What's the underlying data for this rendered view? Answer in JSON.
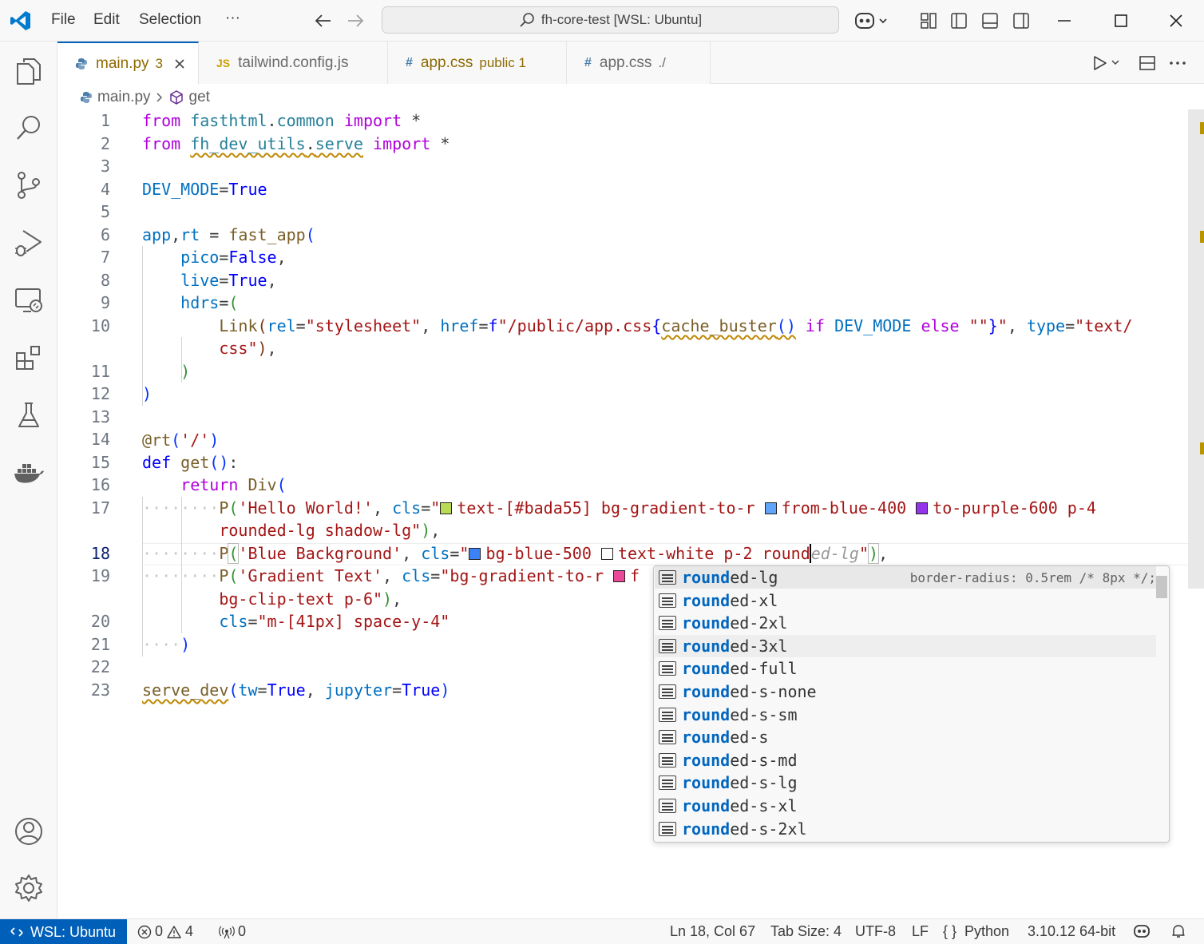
{
  "titlebar": {
    "menu": [
      "File",
      "Edit",
      "Selection"
    ],
    "more": "···",
    "command_center": "fh-core-test [WSL: Ubuntu]"
  },
  "tabs": [
    {
      "icon": "python-icon",
      "label": "main.py",
      "desc": "3",
      "active": true
    },
    {
      "icon": "JS",
      "label": "tailwind.config.js",
      "desc": ""
    },
    {
      "icon": "#",
      "label": "app.css",
      "desc": "public 1"
    },
    {
      "icon": "#",
      "label": "app.css",
      "desc": "./"
    }
  ],
  "breadcrumb": {
    "file": "main.py",
    "symbol": "get"
  },
  "editor": {
    "line_numbers": [
      "1",
      "2",
      "3",
      "4",
      "5",
      "6",
      "7",
      "8",
      "9",
      "10",
      "",
      "11",
      "12",
      "13",
      "14",
      "15",
      "16",
      "17",
      "",
      "18",
      "19",
      "",
      "20",
      "21",
      "22",
      "23"
    ],
    "current_line": "18",
    "code_text": [
      "from fasthtml.common import *",
      "from fh_dev_utils.serve import *",
      "",
      "DEV_MODE=True",
      "",
      "app,rt = fast_app(",
      "pico=False,",
      "live=True,",
      "hdrs=(",
      "Link(rel=\"stylesheet\", href=f\"/public/app.css{cache_buster() if DEV_MODE else \"\"}\", type=\"text/",
      "css\"),",
      ")",
      ")",
      "",
      "@rt('/')",
      "def get():",
      "return Div(",
      "P('Hello World!', cls=\"text-[#bada55] bg-gradient-to-r from-blue-400 to-purple-600 p-4",
      "rounded-lg shadow-lg\"),",
      "P('Blue Background', cls=\"bg-blue-500 text-white p-2 round",
      "P('Gradient Text', cls=\"bg-gradient-to-r f",
      "bg-clip-text p-6\"),",
      "cls=\"m-[41px] space-y-4\"",
      ")",
      "",
      "serve_dev(tw=True, jupyter=True)"
    ],
    "ghost_text": "ed-lg"
  },
  "suggest": {
    "typed": "round",
    "detail": "border-radius: 0.5rem /* 8px */;",
    "items": [
      "rounded-lg",
      "rounded-xl",
      "rounded-2xl",
      "rounded-3xl",
      "rounded-full",
      "rounded-s-none",
      "rounded-s-sm",
      "rounded-s",
      "rounded-s-md",
      "rounded-s-lg",
      "rounded-s-xl",
      "rounded-s-2xl"
    ],
    "completions": [
      "ed-lg",
      "ed-xl",
      "ed-2xl",
      "ed-3xl",
      "ed-full",
      "ed-s-none",
      "ed-s-sm",
      "ed-s",
      "ed-s-md",
      "ed-s-lg",
      "ed-s-xl",
      "ed-s-2xl"
    ],
    "selected_index": 0
  },
  "swatches": {
    "bada55": "#bada55",
    "blue400": "#60a5fa",
    "purple600": "#9333ea",
    "blue500": "#3b82f6",
    "white": "#ffffff",
    "pink": "#ec4899"
  },
  "statusbar": {
    "remote": "WSL: Ubuntu",
    "errors": "0",
    "warnings": "4",
    "ports": "0",
    "position": "Ln 18, Col 67",
    "tab_size": "Tab Size: 4",
    "encoding": "UTF-8",
    "eol": "LF",
    "language": "Python",
    "interpreter": "3.10.12 64-bit"
  },
  "colors": {
    "accent": "#005fb8",
    "warning": "#bf8803"
  }
}
